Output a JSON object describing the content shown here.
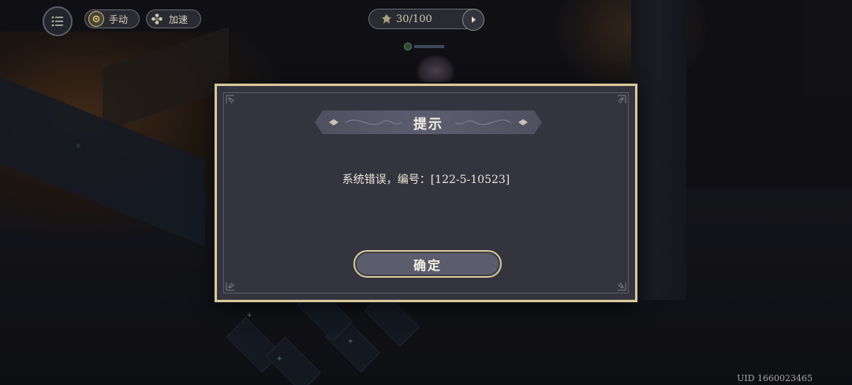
{
  "hud": {
    "menu_icon": "list-menu-icon",
    "manual_label": "手动",
    "manual_icon": "gear-coin-icon",
    "speed_label": "加速",
    "speed_icon": "flower-icon",
    "energy_icon": "energy-leaf-icon",
    "energy_value": "30/100",
    "energy_next_icon": "play-next-icon"
  },
  "dialog": {
    "title": "提示",
    "message": "系统错误，编号：[122-5-10523]",
    "confirm_label": "确定"
  },
  "footer": {
    "uid": "UID 1660023465"
  },
  "colors": {
    "modal_bg": "#33343e",
    "gold_border": "#d8c99a",
    "button_bg": "#5b5d6c"
  }
}
